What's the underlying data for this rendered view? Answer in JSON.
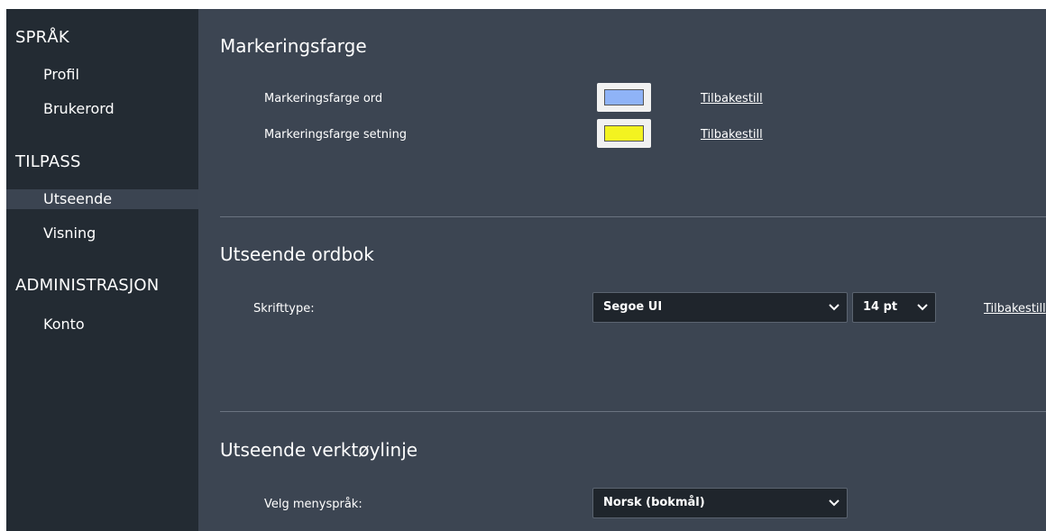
{
  "sidebar": {
    "sections": [
      {
        "title": "SPRÅK",
        "items": [
          "Profil",
          "Brukerord"
        ]
      },
      {
        "title": "TILPASS",
        "items": [
          "Utseende",
          "Visning"
        ]
      },
      {
        "title": "ADMINISTRASJON",
        "items": [
          "Konto"
        ]
      }
    ],
    "active_item": "Utseende"
  },
  "highlight": {
    "title": "Markeringsfarge",
    "word_label": "Markeringsfarge ord",
    "word_color": "#8fb3f7",
    "sentence_label": "Markeringsfarge setning",
    "sentence_color": "#f3f320",
    "reset_label": "Tilbakestill"
  },
  "dictionary": {
    "title": "Utseende ordbok",
    "font_label": "Skrifttype:",
    "font_value": "Segoe UI",
    "size_value": "14 pt",
    "reset_label": "Tilbakestill"
  },
  "toolbar": {
    "title": "Utseende verktøylinje",
    "menu_lang_label": "Velg menyspråk:",
    "menu_lang_value": "Norsk (bokmål)"
  }
}
